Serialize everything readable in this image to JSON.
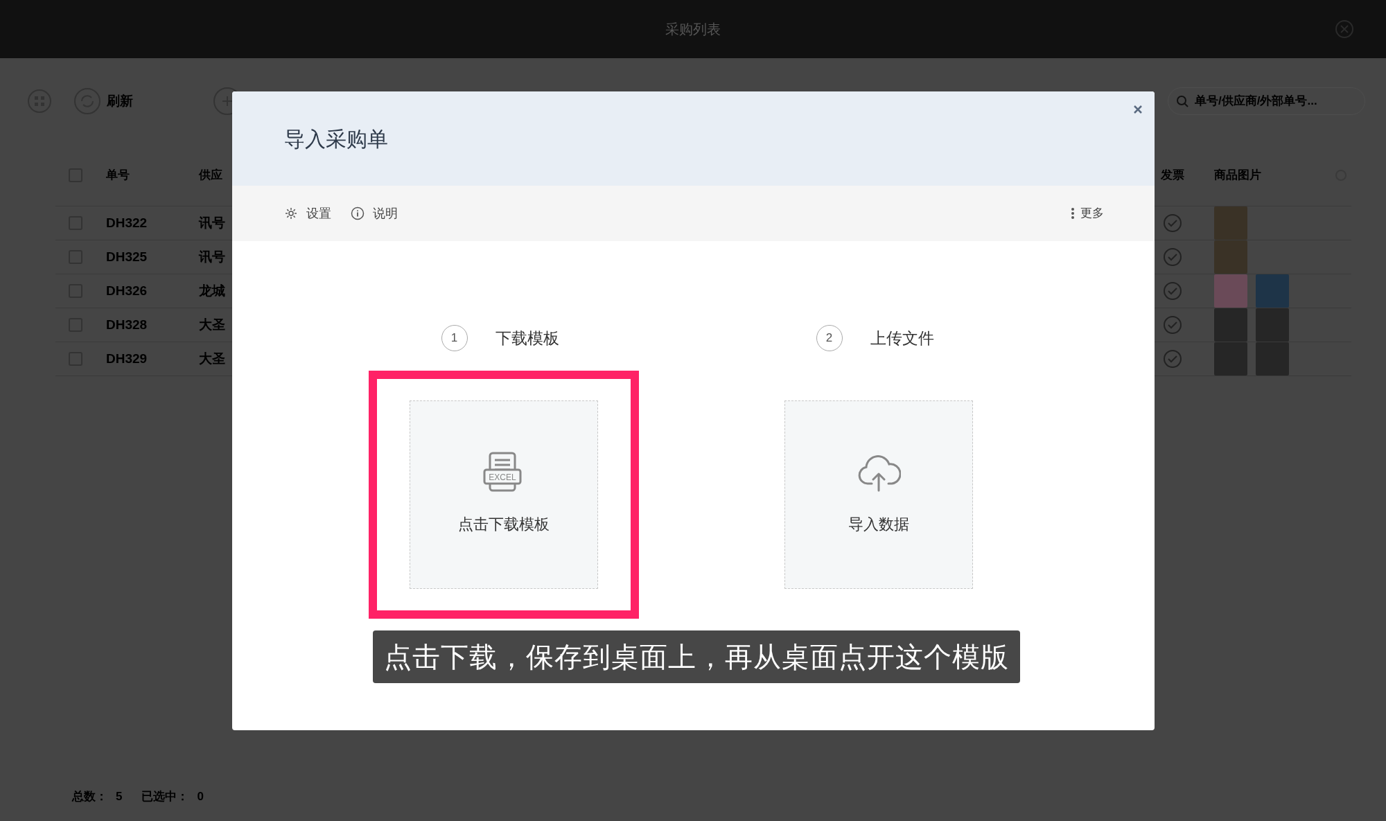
{
  "app": {
    "title": "采购列表"
  },
  "toolbar": {
    "refresh": "刷新",
    "search_placeholder": "单号/供应商/外部单号..."
  },
  "table": {
    "columns": [
      "单号",
      "供应",
      "发票",
      "商品图片"
    ],
    "select_all_checked": false,
    "rows": [
      {
        "number": "DH322",
        "supplier": "讯号",
        "checked": false,
        "photos": [
          {
            "kind": "stool"
          }
        ]
      },
      {
        "number": "DH325",
        "supplier": "讯号",
        "checked": false,
        "photos": [
          {
            "kind": "stool"
          }
        ]
      },
      {
        "number": "DH326",
        "supplier": "龙城",
        "checked": false,
        "photos": [
          {
            "kind": "bottle"
          },
          {
            "kind": "picture"
          }
        ]
      },
      {
        "number": "DH328",
        "supplier": "大圣",
        "checked": false,
        "photos": [
          {
            "kind": "glasses"
          },
          {
            "kind": "glasses"
          }
        ]
      },
      {
        "number": "DH329",
        "supplier": "大圣",
        "checked": false,
        "photos": [
          {
            "kind": "glasses"
          },
          {
            "kind": "glasses"
          }
        ]
      }
    ]
  },
  "footer": {
    "total_label": "总数：",
    "total": "5",
    "selected_label": "已选中：",
    "selected": "0"
  },
  "dialog": {
    "title": "导入采购单",
    "tools": [
      {
        "kind": "gear",
        "label": "设置"
      },
      {
        "kind": "info",
        "label": "说明"
      }
    ],
    "more": "更多",
    "steps": [
      {
        "number": "1",
        "label": "下载模板",
        "kind": "excel",
        "icon_text": "EXCEL",
        "card_label": "点击下载模板",
        "highlighted": true
      },
      {
        "number": "2",
        "label": "上传文件",
        "kind": "upload",
        "card_label": "导入数据",
        "highlighted": false
      }
    ],
    "caption": "点击下载，保存到桌面上，再从桌面点开这个模版"
  }
}
